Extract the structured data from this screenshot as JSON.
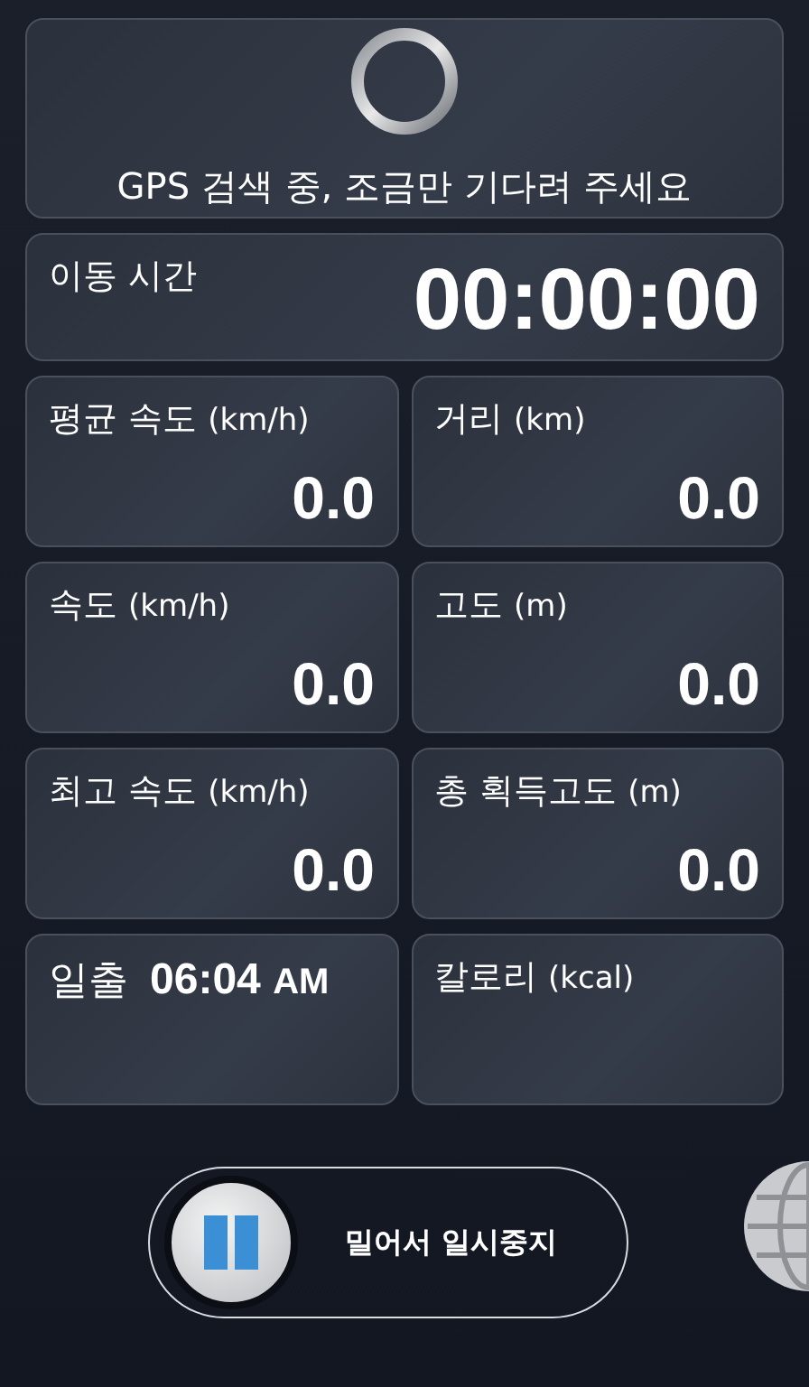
{
  "gps_status": {
    "message": "GPS 검색 중, 조금만 기다려 주세요"
  },
  "moving_time": {
    "label": "이동 시간",
    "value": "00:00:00"
  },
  "stats": [
    {
      "kind": "metric",
      "label": "평균 속도",
      "unit": "(km/h)",
      "value": "0.0"
    },
    {
      "kind": "metric",
      "label": "거리",
      "unit": "(km)",
      "value": "0.0"
    },
    {
      "kind": "metric",
      "label": "속도",
      "unit": "(km/h)",
      "value": "0.0"
    },
    {
      "kind": "metric",
      "label": "고도",
      "unit": "(m)",
      "value": "0.0"
    },
    {
      "kind": "metric",
      "label": "최고 속도",
      "unit": "(km/h)",
      "value": "0.0"
    },
    {
      "kind": "metric",
      "label": "총 획득고도",
      "unit": "(m)",
      "value": "0.0"
    },
    {
      "kind": "sun",
      "label": "일출",
      "value": "06:04",
      "suffix": "AM"
    },
    {
      "kind": "metric",
      "label": "칼로리",
      "unit": "(kcal)"
    }
  ],
  "slider": {
    "label": "밀어서 일시중지"
  }
}
